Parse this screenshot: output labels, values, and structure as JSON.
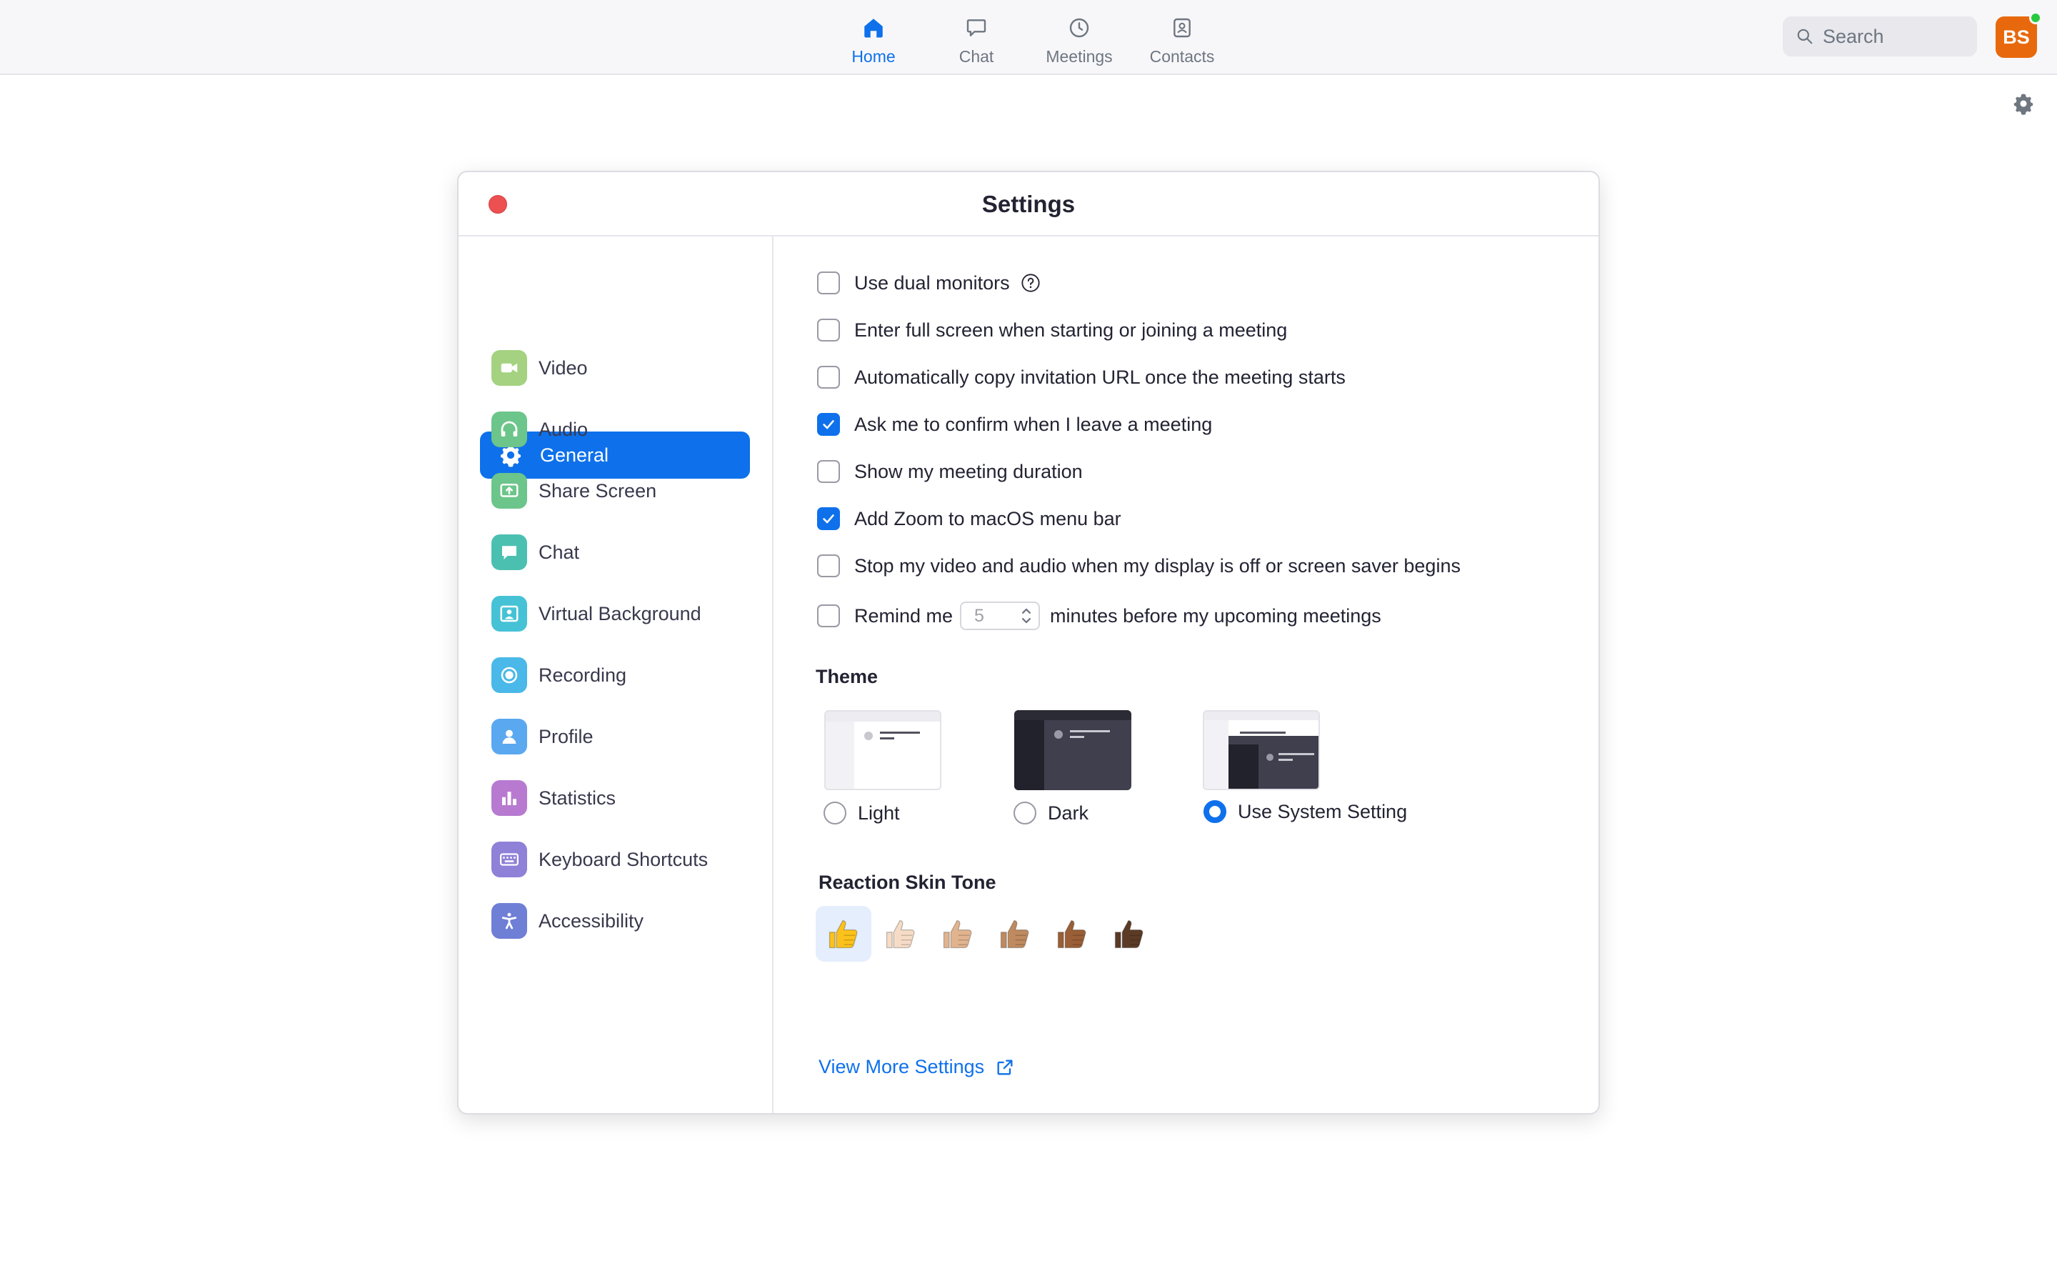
{
  "nav": {
    "tabs": [
      {
        "label": "Home",
        "icon": "home-icon",
        "active": true
      },
      {
        "label": "Chat",
        "icon": "chat-icon",
        "active": false
      },
      {
        "label": "Meetings",
        "icon": "clock-icon",
        "active": false
      },
      {
        "label": "Contacts",
        "icon": "contacts-icon",
        "active": false
      }
    ],
    "search_label": "Search",
    "avatar_initials": "BS"
  },
  "settings": {
    "title": "Settings",
    "sidebar": [
      {
        "label": "General",
        "icon": "gear-icon",
        "active": true,
        "color": "#0e71eb"
      },
      {
        "label": "Video",
        "icon": "video-camera-icon",
        "color": "#a4d280"
      },
      {
        "label": "Audio",
        "icon": "headphones-icon",
        "color": "#6cc58a"
      },
      {
        "label": "Share Screen",
        "icon": "share-screen-icon",
        "color": "#6cc58a"
      },
      {
        "label": "Chat",
        "icon": "chat-bubble-icon",
        "color": "#4cc0b0"
      },
      {
        "label": "Virtual Background",
        "icon": "virtual-background-icon",
        "color": "#46c2d6"
      },
      {
        "label": "Recording",
        "icon": "record-icon",
        "color": "#4ab8e8"
      },
      {
        "label": "Profile",
        "icon": "profile-icon",
        "color": "#5aa8f0"
      },
      {
        "label": "Statistics",
        "icon": "statistics-icon",
        "color": "#b77ad0"
      },
      {
        "label": "Keyboard Shortcuts",
        "icon": "keyboard-icon",
        "color": "#8f80d8"
      },
      {
        "label": "Accessibility",
        "icon": "accessibility-icon",
        "color": "#6f7fd6"
      }
    ],
    "options": [
      {
        "label": "Use dual monitors",
        "checked": false,
        "help": true
      },
      {
        "label": "Enter full screen when starting or joining a meeting",
        "checked": false
      },
      {
        "label": "Automatically copy invitation URL once the meeting starts",
        "checked": false
      },
      {
        "label": "Ask me to confirm when I leave a meeting",
        "checked": true
      },
      {
        "label": "Show my meeting duration",
        "checked": false
      },
      {
        "label": "Add Zoom to macOS menu bar",
        "checked": true
      },
      {
        "label": "Stop my video and audio when my display is off or screen saver begins",
        "checked": false
      }
    ],
    "remind": {
      "prefix": "Remind me",
      "value": "5",
      "suffix": "minutes before my upcoming meetings",
      "checked": false
    },
    "theme": {
      "title": "Theme",
      "options": [
        {
          "label": "Light",
          "selected": false
        },
        {
          "label": "Dark",
          "selected": false
        },
        {
          "label": "Use System Setting",
          "selected": true
        }
      ]
    },
    "skin_tone": {
      "title": "Reaction Skin Tone",
      "tones": [
        "#fcc21b",
        "#f6dcc6",
        "#e1b48f",
        "#bf8a60",
        "#9a5f36",
        "#5c3b26"
      ],
      "selected_index": 0
    },
    "more_link": "View More Settings"
  }
}
